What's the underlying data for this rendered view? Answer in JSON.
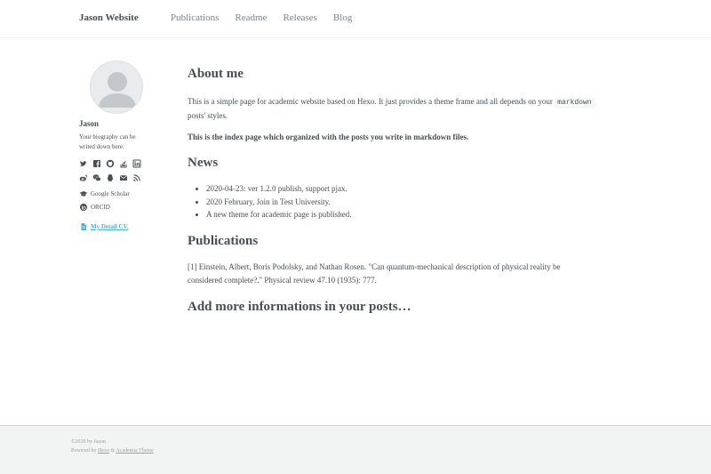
{
  "header": {
    "site_title": "Jason Website",
    "nav": [
      "Publications",
      "Readme",
      "Releases",
      "Blog"
    ]
  },
  "sidebar": {
    "name": "Jason",
    "bio": "Your biography can be writed down here.",
    "social_icons_row1": [
      "twitter-icon",
      "facebook-icon",
      "github-icon",
      "stackoverflow-icon",
      "linkedin-icon"
    ],
    "social_icons_row2": [
      "weibo-icon",
      "wechat-icon",
      "qq-icon",
      "email-icon",
      "rss-icon"
    ],
    "google_scholar": "Google Scholar",
    "orcid": "ORCID",
    "cv_link": "My Detail CV."
  },
  "main": {
    "about_title": "About me",
    "about_text_before": "This is a simple page for academic website based on Hexo. It just provides a theme frame and all depends on your",
    "about_code": "markdown",
    "about_text_after": "posts' styles.",
    "index_note": "This is the index page which organized with the posts you write in markdown files.",
    "news_title": "News",
    "news_items": [
      "2020-04-23: ver 1.2.0 publish, support pjax.",
      "2020 February, Join in Test University.",
      "A new theme for academic page is published."
    ],
    "publications_title": "Publications",
    "publication_1_line1": "[1] Einstein, Albert, Boris Podolsky, and Nathan Rosen. \"Can quantum-mechanical description of physical reality be",
    "publication_1_line2": "considered complete?.\" Physical review 47.10 (1935): 777.",
    "more_title": "Add more informations in your posts…"
  },
  "footer": {
    "copyright": "©2020 by Jason",
    "powered_by": "Powered by",
    "hexo": "Hexo",
    "amp": "&",
    "theme": "Academia Theme"
  },
  "colors": {
    "text": "#494e52",
    "nav": "#7a8288",
    "link": "#52adc8",
    "footer_bg": "#f2f3f3"
  }
}
